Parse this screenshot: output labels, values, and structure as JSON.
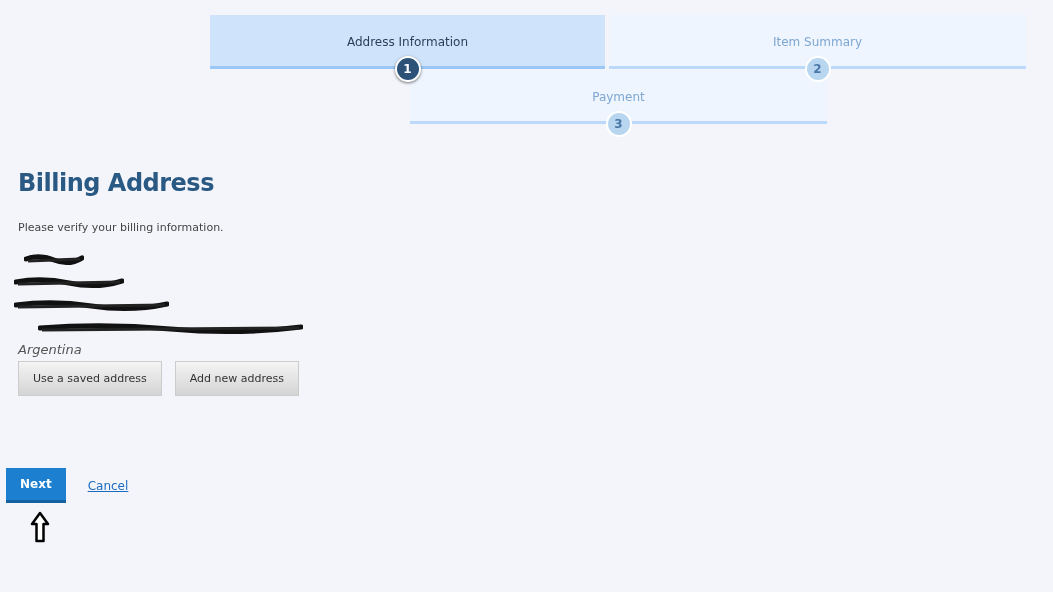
{
  "steps": [
    {
      "label": "Address Information",
      "number": "1",
      "selected": true
    },
    {
      "label": "Item Summary",
      "number": "2",
      "selected": false
    },
    {
      "label": "Payment",
      "number": "3",
      "selected": false
    }
  ],
  "heading": "Billing Address",
  "instruction": "Please verify your billing information.",
  "address_lines": [
    {
      "kind": "redacted"
    },
    {
      "kind": "redacted"
    },
    {
      "kind": "redacted"
    },
    {
      "kind": "redacted"
    },
    {
      "kind": "text",
      "text": "Argentina"
    }
  ],
  "address_buttons": [
    "Use a saved address",
    "Add new address"
  ],
  "next_button": "Next",
  "cancel_link": "Cancel"
}
